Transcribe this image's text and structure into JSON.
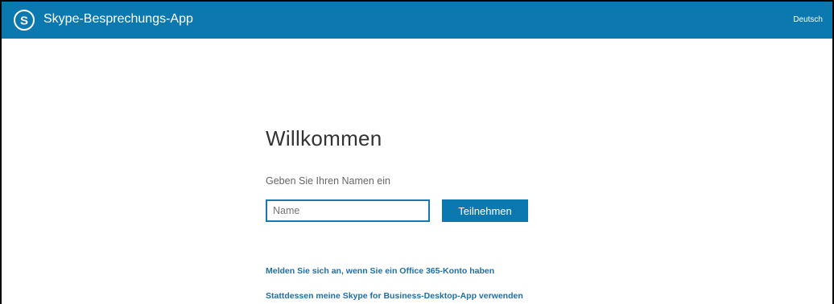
{
  "header": {
    "app_title": "Skype-Besprechungs-App",
    "logo_icon": "skype-logo-icon",
    "language": "Deutsch",
    "bar_color": "#0b78b0"
  },
  "main": {
    "welcome": "Willkommen",
    "prompt": "Geben Sie Ihren Namen ein",
    "name_input": {
      "value": "",
      "placeholder": "Name"
    },
    "join_button": "Teilnehmen",
    "links": {
      "sign_in": "Melden Sie sich an, wenn Sie ein Office 365-Konto haben",
      "desktop_app": "Stattdessen meine Skype for Business-Desktop-App verwenden"
    }
  },
  "colors": {
    "accent": "#0b78b0",
    "link": "#1e6fa8",
    "heading": "#333333",
    "muted": "#666666"
  }
}
